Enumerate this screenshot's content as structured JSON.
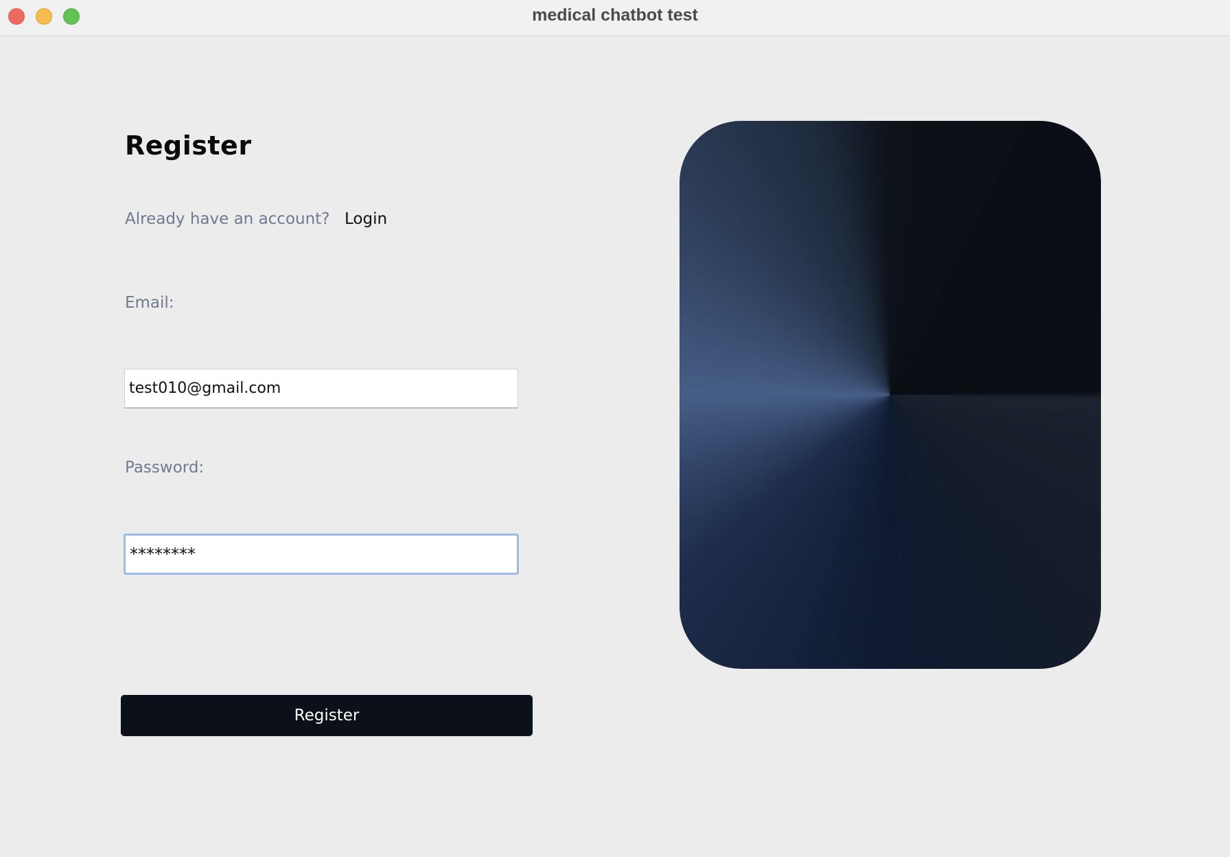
{
  "window": {
    "title": "medical chatbot test"
  },
  "form": {
    "heading": "Register",
    "already_prompt": "Already have an account?",
    "login_link": "Login",
    "email_label": "Email:",
    "email_value": "test010@gmail.com",
    "password_label": "Password:",
    "password_value": "********",
    "submit_label": "Register"
  },
  "icons": {
    "close": "close-traffic-light-icon",
    "minimize": "minimize-traffic-light-icon",
    "maximize": "maximize-traffic-light-icon"
  },
  "colors": {
    "background": "#ececec",
    "button": "#0b1019",
    "muted_text": "#6e7a8e",
    "focus_ring": "#9dbbe6"
  }
}
